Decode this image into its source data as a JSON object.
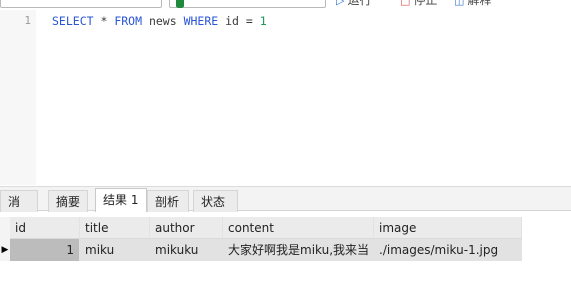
{
  "toolbar": {
    "run_label": "运行",
    "stop_label": "停止",
    "explain_label": "解释"
  },
  "editor": {
    "line_number": "1",
    "sql": {
      "select": "SELECT",
      "star": " * ",
      "from": "FROM",
      "table": " news ",
      "where": "WHERE",
      "cond": " id = ",
      "value": "1"
    }
  },
  "tabs": [
    {
      "label": "消息"
    },
    {
      "label": "摘要"
    },
    {
      "label": "结果 1",
      "active": true
    },
    {
      "label": "剖析"
    },
    {
      "label": "状态"
    }
  ],
  "grid": {
    "columns": [
      "id",
      "title",
      "author",
      "content",
      "image"
    ],
    "rows": [
      [
        "1",
        "miku",
        "mikuku",
        "大家好啊我是miku,我来当",
        "./images/miku-1.jpg"
      ]
    ],
    "row_indicator": "▶"
  }
}
